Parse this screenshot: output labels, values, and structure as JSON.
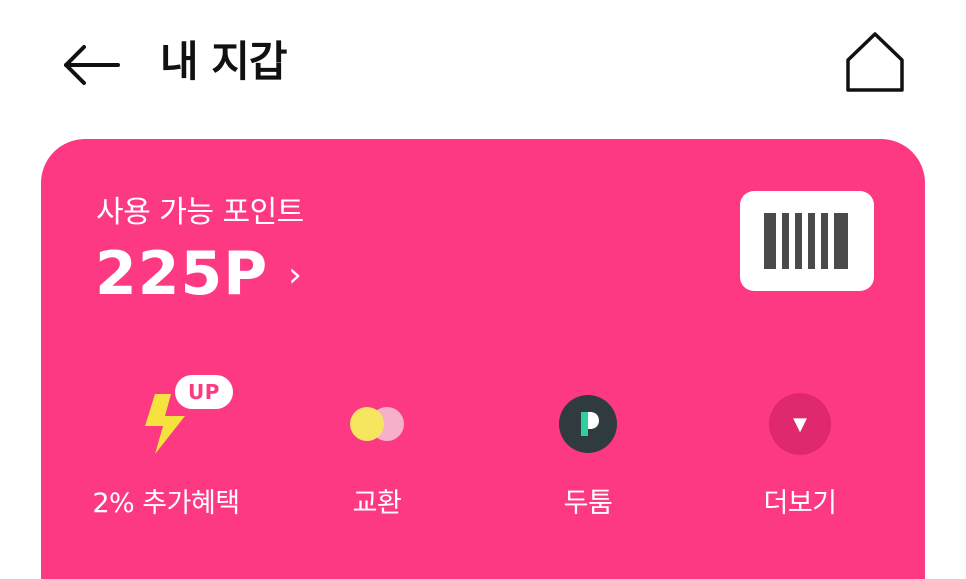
{
  "header": {
    "title": "내 지갑",
    "back_icon": "arrow-left-icon",
    "home_icon": "home-icon"
  },
  "wallet_card": {
    "background_color": "#fd3984",
    "points_label": "사용 가능 포인트",
    "points_value": "225P",
    "points_chevron": "›",
    "barcode_icon": "barcode-icon"
  },
  "menu": [
    {
      "label": "2% 추가혜택",
      "icon": "lightning-icon",
      "badge": "UP"
    },
    {
      "label": "교환",
      "icon": "exchange-coins-icon"
    },
    {
      "label": "두툼",
      "icon": "dooteum-logo-icon",
      "icon_letter": "P"
    },
    {
      "label": "더보기",
      "icon": "dropdown-arrow-icon",
      "icon_glyph": "▼"
    }
  ]
}
